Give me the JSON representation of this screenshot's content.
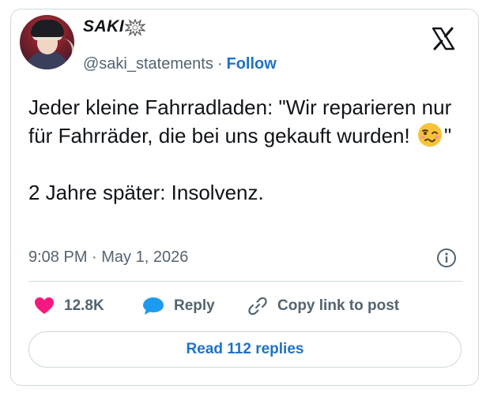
{
  "author": {
    "name": "SAKI",
    "handle": "@saki_statements",
    "separator": "·",
    "follow_label": "Follow"
  },
  "tweet": {
    "text_part1": "Jeder kleine Fahrradladen: \"Wir reparieren nur für Fahrräder, die bei uns gekauft wurden!",
    "text_part2": "\"\n\n2 Jahre später: Insolvenz.",
    "emoji": "woozy-face-emoji"
  },
  "meta": {
    "timestamp": "9:08 PM · May 1, 2026"
  },
  "actions": {
    "like_count": "12.8K",
    "reply_label": "Reply",
    "copy_label": "Copy link to post"
  },
  "footer": {
    "read_replies_label": "Read 112 replies"
  },
  "colors": {
    "accent": "#1d72c7",
    "like": "#f91880",
    "reply": "#1d9bf0",
    "muted": "#536471",
    "border": "#cfd9de"
  }
}
